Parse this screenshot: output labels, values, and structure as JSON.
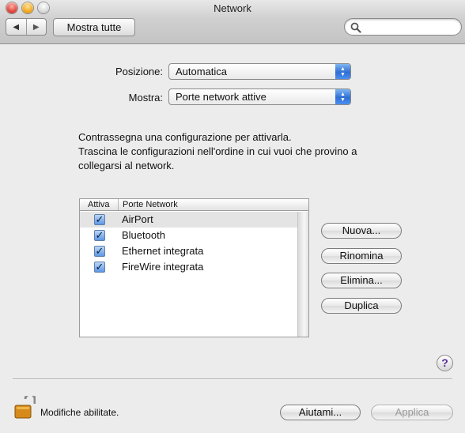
{
  "window": {
    "title": "Network"
  },
  "toolbar": {
    "back_glyph": "◀",
    "forward_glyph": "▶",
    "show_all_label": "Mostra tutte",
    "search_placeholder": "",
    "search_icon": "magnifier-icon"
  },
  "location": {
    "label": "Posizione:",
    "value": "Automatica"
  },
  "show": {
    "label": "Mostra:",
    "value": "Porte network attive"
  },
  "instructions": [
    "Contrassegna una configurazione per attivarla.",
    "Trascina le configurazioni nell'ordine in cui vuoi che provino a",
    "collegarsi al network."
  ],
  "ports_table": {
    "col_active": "Attiva",
    "col_ports": "Porte Network",
    "check_glyph": "✓",
    "rows": [
      {
        "name": "AirPort",
        "active": true,
        "selected": true
      },
      {
        "name": "Bluetooth",
        "active": true,
        "selected": false
      },
      {
        "name": "Ethernet integrata",
        "active": true,
        "selected": false
      },
      {
        "name": "FireWire integrata",
        "active": true,
        "selected": false
      }
    ]
  },
  "side_buttons": {
    "new": "Nuova...",
    "rename": "Rinomina",
    "delete": "Elimina...",
    "duplicate": "Duplica"
  },
  "help_glyph": "?",
  "footer": {
    "lock_text": "Modifiche abilitate.",
    "assist": "Aiutami...",
    "apply": "Applica",
    "apply_enabled": false
  },
  "colors": {
    "popup_arrow": "#2f6fd3",
    "checkbox": "#5d97e5",
    "help_glyph": "#5a2d9a",
    "lock": "#d68a1a"
  }
}
